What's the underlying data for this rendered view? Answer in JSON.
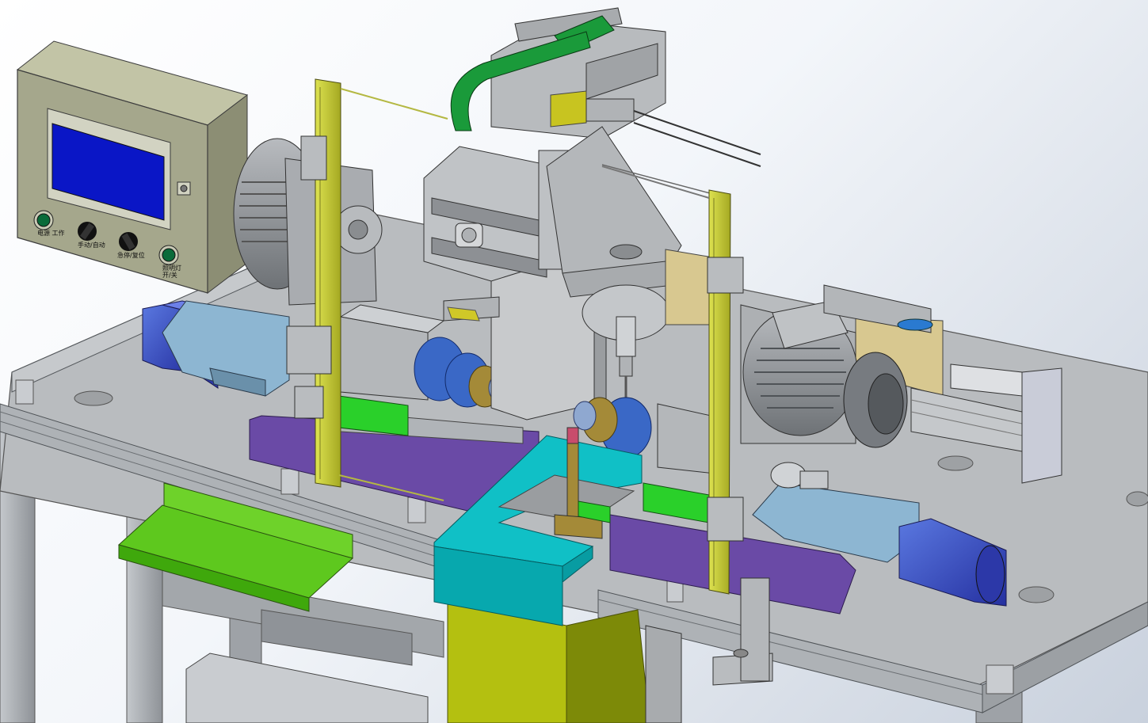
{
  "control_panel": {
    "labels": {
      "btn1": "电源 工作",
      "knob1": "手动/自动",
      "knob2": "急停/复位",
      "btn2": "照明灯 开/关"
    }
  },
  "colors": {
    "frame": "#a9adb2",
    "frame_dark": "#7d8186",
    "table_top": "#b9bcbf",
    "light_curtain": "#c8cc3c",
    "screen": "#0a16c6",
    "servo_motor": "#3a46c8",
    "slide_cover": "#8db6d2",
    "purple_plate": "#6a4aa6",
    "green_part": "#2ad02a",
    "cyan_tray": "#10c0c6",
    "chute_green": "#6ed22a",
    "bearing_blue": "#3a68c6",
    "bronze": "#a48a38",
    "yellow_column": "#b4c010",
    "cable_chain": "#1a9a3a",
    "tan_block": "#d8c890"
  },
  "icons": [
    "power-button-icon",
    "selector-knob-icon",
    "emergency-knob-icon",
    "light-button-icon"
  ]
}
